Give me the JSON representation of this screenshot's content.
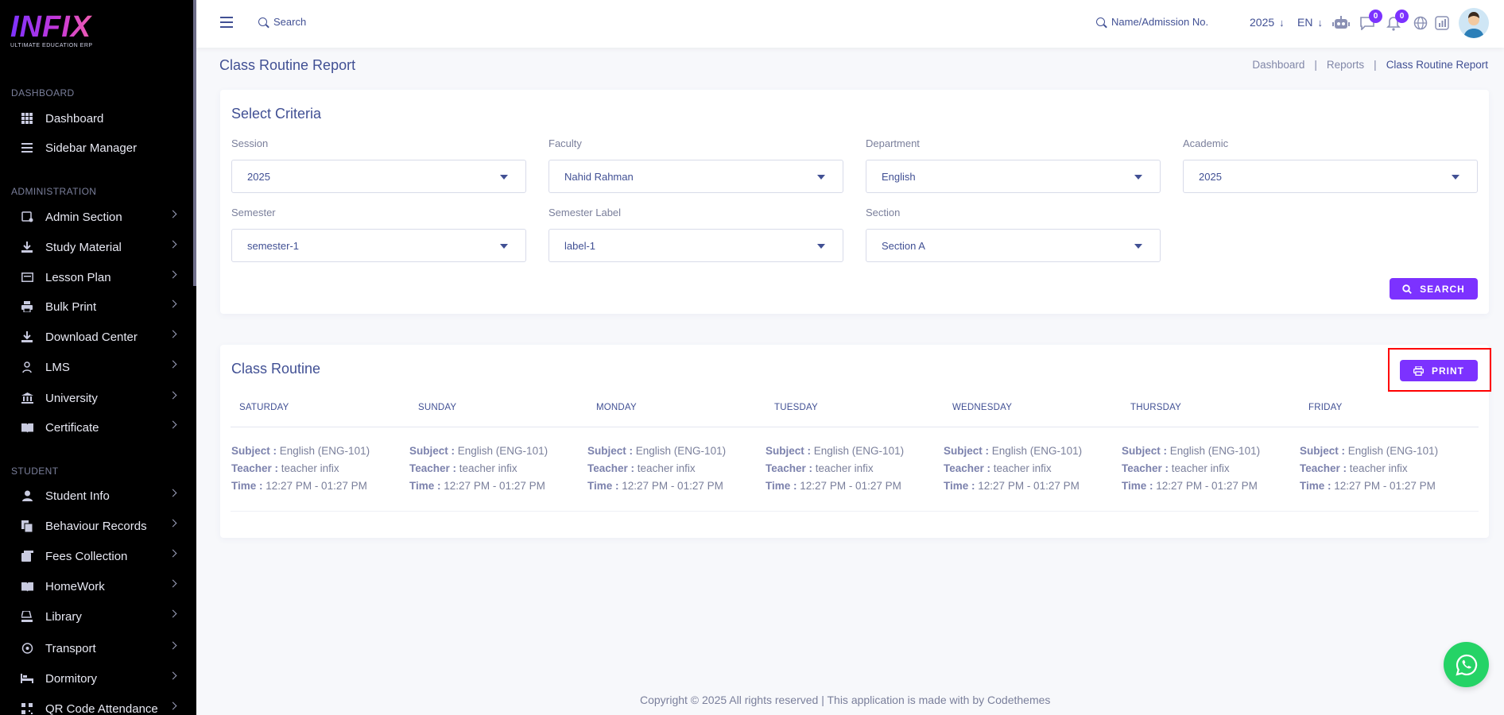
{
  "brand": {
    "logo": "INFIX",
    "tagline": "ULTIMATE EDUCATION ERP"
  },
  "sidebar": {
    "sections": [
      {
        "title": "DASHBOARD"
      },
      {
        "title": "ADMINISTRATION"
      },
      {
        "title": "STUDENT"
      }
    ],
    "items": [
      {
        "label": "Dashboard",
        "icon": "grid-icon"
      },
      {
        "label": "Sidebar Manager",
        "icon": "list-icon"
      },
      {
        "label": "Admin Section",
        "icon": "admin-icon"
      },
      {
        "label": "Study Material",
        "icon": "download-icon"
      },
      {
        "label": "Lesson Plan",
        "icon": "board-icon"
      },
      {
        "label": "Bulk Print",
        "icon": "printer-icon"
      },
      {
        "label": "Download Center",
        "icon": "download-icon"
      },
      {
        "label": "LMS",
        "icon": "user-icon"
      },
      {
        "label": "University",
        "icon": "university-icon"
      },
      {
        "label": "Certificate",
        "icon": "book-icon"
      },
      {
        "label": "Student Info",
        "icon": "user-icon"
      },
      {
        "label": "Behaviour Records",
        "icon": "files-icon"
      },
      {
        "label": "Fees Collection",
        "icon": "fees-icon"
      },
      {
        "label": "HomeWork",
        "icon": "book-icon"
      },
      {
        "label": "Library",
        "icon": "library-icon"
      },
      {
        "label": "Transport",
        "icon": "transport-icon"
      },
      {
        "label": "Dormitory",
        "icon": "bed-icon"
      },
      {
        "label": "QR Code Attendance",
        "icon": "qr-icon"
      }
    ]
  },
  "header": {
    "search_label": "Search",
    "name_search_label": "Name/Admission No.",
    "year": "2025",
    "lang": "EN",
    "chat_count": "0",
    "notification_count": "0"
  },
  "page": {
    "title": "Class Routine Report",
    "breadcrumb": [
      "Dashboard",
      "Reports",
      "Class Routine Report"
    ]
  },
  "criteria": {
    "title": "Select Criteria",
    "fields": [
      {
        "label": "Session",
        "value": "2025"
      },
      {
        "label": "Faculty",
        "value": "Nahid Rahman"
      },
      {
        "label": "Department",
        "value": "English"
      },
      {
        "label": "Academic",
        "value": "2025"
      },
      {
        "label": "Semester",
        "value": "semester-1"
      },
      {
        "label": "Semester Label",
        "value": "label-1"
      },
      {
        "label": "Section",
        "value": "Section A"
      }
    ],
    "search_button": "SEARCH"
  },
  "routine": {
    "title": "Class Routine",
    "print_button": "PRINT",
    "labels": {
      "subject": "Subject :",
      "teacher": "Teacher :",
      "time": "Time :"
    },
    "days": [
      {
        "day": "SATURDAY",
        "subject": "English (ENG-101)",
        "teacher": "teacher infix",
        "time": "12:27 PM - 01:27 PM"
      },
      {
        "day": "SUNDAY",
        "subject": "English (ENG-101)",
        "teacher": "teacher infix",
        "time": "12:27 PM - 01:27 PM"
      },
      {
        "day": "MONDAY",
        "subject": "English (ENG-101)",
        "teacher": "teacher infix",
        "time": "12:27 PM - 01:27 PM"
      },
      {
        "day": "TUESDAY",
        "subject": "English (ENG-101)",
        "teacher": "teacher infix",
        "time": "12:27 PM - 01:27 PM"
      },
      {
        "day": "WEDNESDAY",
        "subject": "English (ENG-101)",
        "teacher": "teacher infix",
        "time": "12:27 PM - 01:27 PM"
      },
      {
        "day": "THURSDAY",
        "subject": "English (ENG-101)",
        "teacher": "teacher infix",
        "time": "12:27 PM - 01:27 PM"
      },
      {
        "day": "FRIDAY",
        "subject": "English (ENG-101)",
        "teacher": "teacher infix",
        "time": "12:27 PM - 01:27 PM"
      }
    ]
  },
  "footer": {
    "text": "Copyright © 2025 All rights reserved | This application is made with by Codethemes"
  },
  "colors": {
    "primary": "#7c32ff",
    "text": "#415094",
    "sidebar_bg": "#000000",
    "highlight": "#ff0000",
    "whatsapp": "#25d366"
  }
}
